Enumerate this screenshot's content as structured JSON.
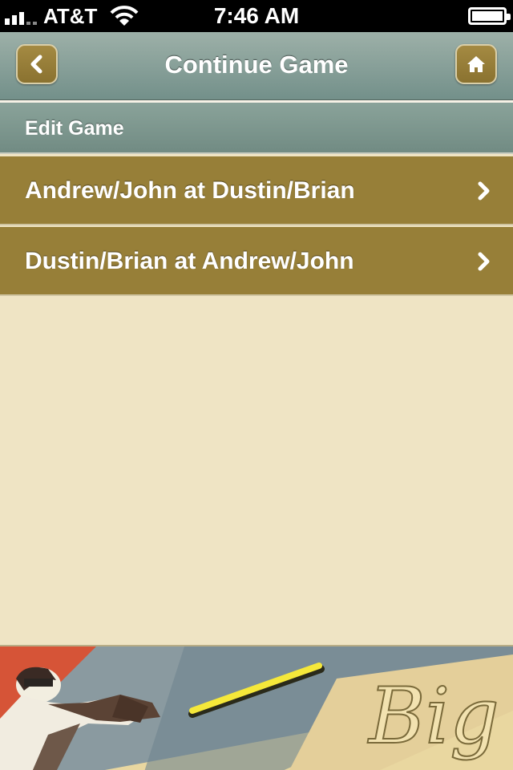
{
  "status_bar": {
    "carrier": "AT&T",
    "time": "7:46 AM",
    "signal_bars": 3,
    "battery_level": 1.0
  },
  "nav_bar": {
    "title": "Continue Game",
    "back_icon": "chevron-left-icon",
    "home_icon": "home-icon"
  },
  "section": {
    "header": "Edit Game"
  },
  "games": [
    {
      "label": "Andrew/John at Dustin/Brian"
    },
    {
      "label": "Dustin/Brian at Andrew/John"
    }
  ],
  "banner": {
    "logo_text": "Big"
  },
  "colors": {
    "nav_gradient_top": "#9db0a8",
    "nav_gradient_bottom": "#73908a",
    "button_gold": "#977f38",
    "background_cream": "#efe4c4"
  }
}
